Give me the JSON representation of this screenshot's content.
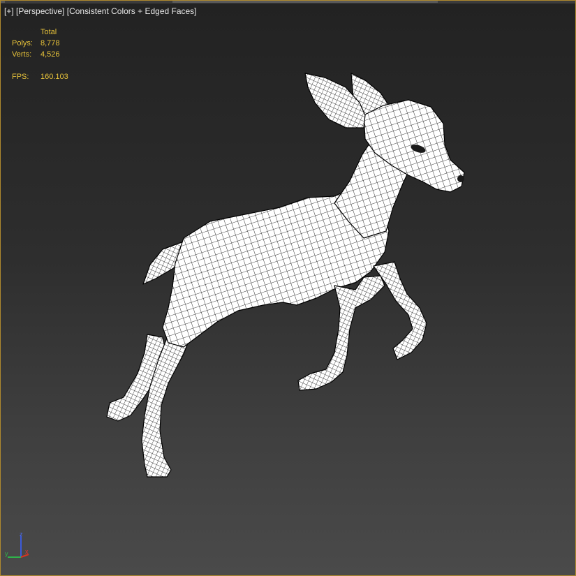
{
  "viewport": {
    "menu_label": "[+]",
    "view_label": "[Perspective]",
    "shading_label": "[Consistent Colors + Edged Faces]"
  },
  "stats": {
    "total_header": "Total",
    "polys_label": "Polys:",
    "polys_value": "8,778",
    "verts_label": "Verts:",
    "verts_value": "4,526",
    "fps_label": "FPS:",
    "fps_value": "160.103"
  },
  "axis_gizmo": {
    "z_label": "z",
    "x_label": "x",
    "y_label": "y"
  },
  "colors": {
    "viewport_border": "#b08a2e",
    "stats_text": "#e8c33a",
    "mesh_fill": "#ffffff",
    "mesh_edges": "#000000"
  },
  "model": {
    "icon": "deer-wireframe-mesh"
  }
}
